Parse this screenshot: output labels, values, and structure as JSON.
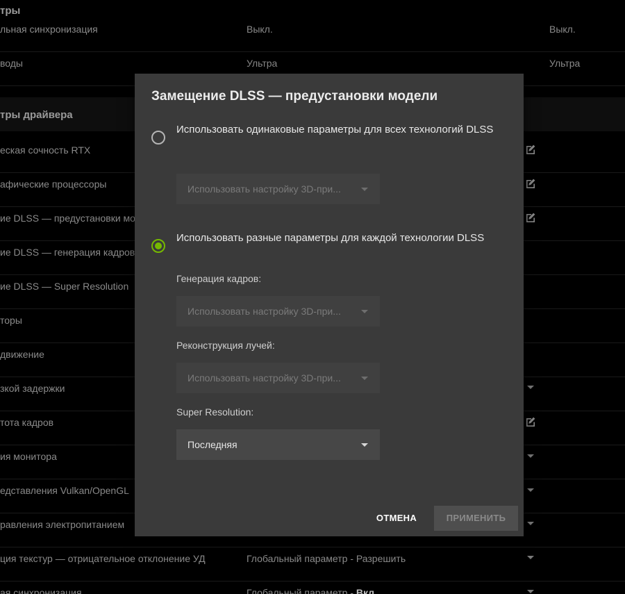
{
  "background": {
    "rows": [
      {
        "name": "тры",
        "section": true
      },
      {
        "name": "льная синхронизация",
        "value": "Выкл.",
        "value2": "Выкл."
      },
      {
        "name": "воды",
        "value": "Ультра",
        "value2": "Ультра"
      },
      {
        "name": "тры драйвера",
        "section": true
      },
      {
        "name": "еская сочность RTX"
      },
      {
        "name": "афические процессоры"
      },
      {
        "name": "ие DLSS — предустановки мо"
      },
      {
        "name": "ие DLSS — генерация кадров"
      },
      {
        "name": "ие DLSS — Super Resolution"
      },
      {
        "name": "торы"
      },
      {
        "name": "движение"
      },
      {
        "name": "зкой задержки"
      },
      {
        "name": "тота кадров"
      },
      {
        "name": "ия монитора"
      },
      {
        "name": "едставления Vulkan/OpenGL"
      },
      {
        "name": "равления электропитанием"
      },
      {
        "name": "ция текстур — отрицательное отклонение УД",
        "value": "Глобальный параметр - Разрешить"
      },
      {
        "name": "ая синхронизация",
        "value": "Глобальный параметр - ",
        "value_bold": "Вкл"
      }
    ]
  },
  "modal": {
    "title": "Замещение DLSS — предустановки модели",
    "option_same": {
      "label": "Использовать одинаковые параметры для всех технологий DLSS",
      "selected": false,
      "select_value": "Использовать настройку 3D-при..."
    },
    "option_different": {
      "label": "Использовать разные параметры для каждой технологии DLSS",
      "selected": true
    },
    "frame_generation": {
      "label": "Генерация кадров:",
      "value": "Использовать настройку 3D-при..."
    },
    "ray_reconstruction": {
      "label": "Реконструкция лучей:",
      "value": "Использовать настройку 3D-при..."
    },
    "super_resolution": {
      "label": "Super Resolution:",
      "value": "Последняя"
    },
    "cancel_label": "ОТМЕНА",
    "apply_label": "ПРИМЕНИТЬ"
  },
  "colors": {
    "accent": "#76b900",
    "modal_bg": "#3a3a3a",
    "page_bg": "#000000"
  }
}
